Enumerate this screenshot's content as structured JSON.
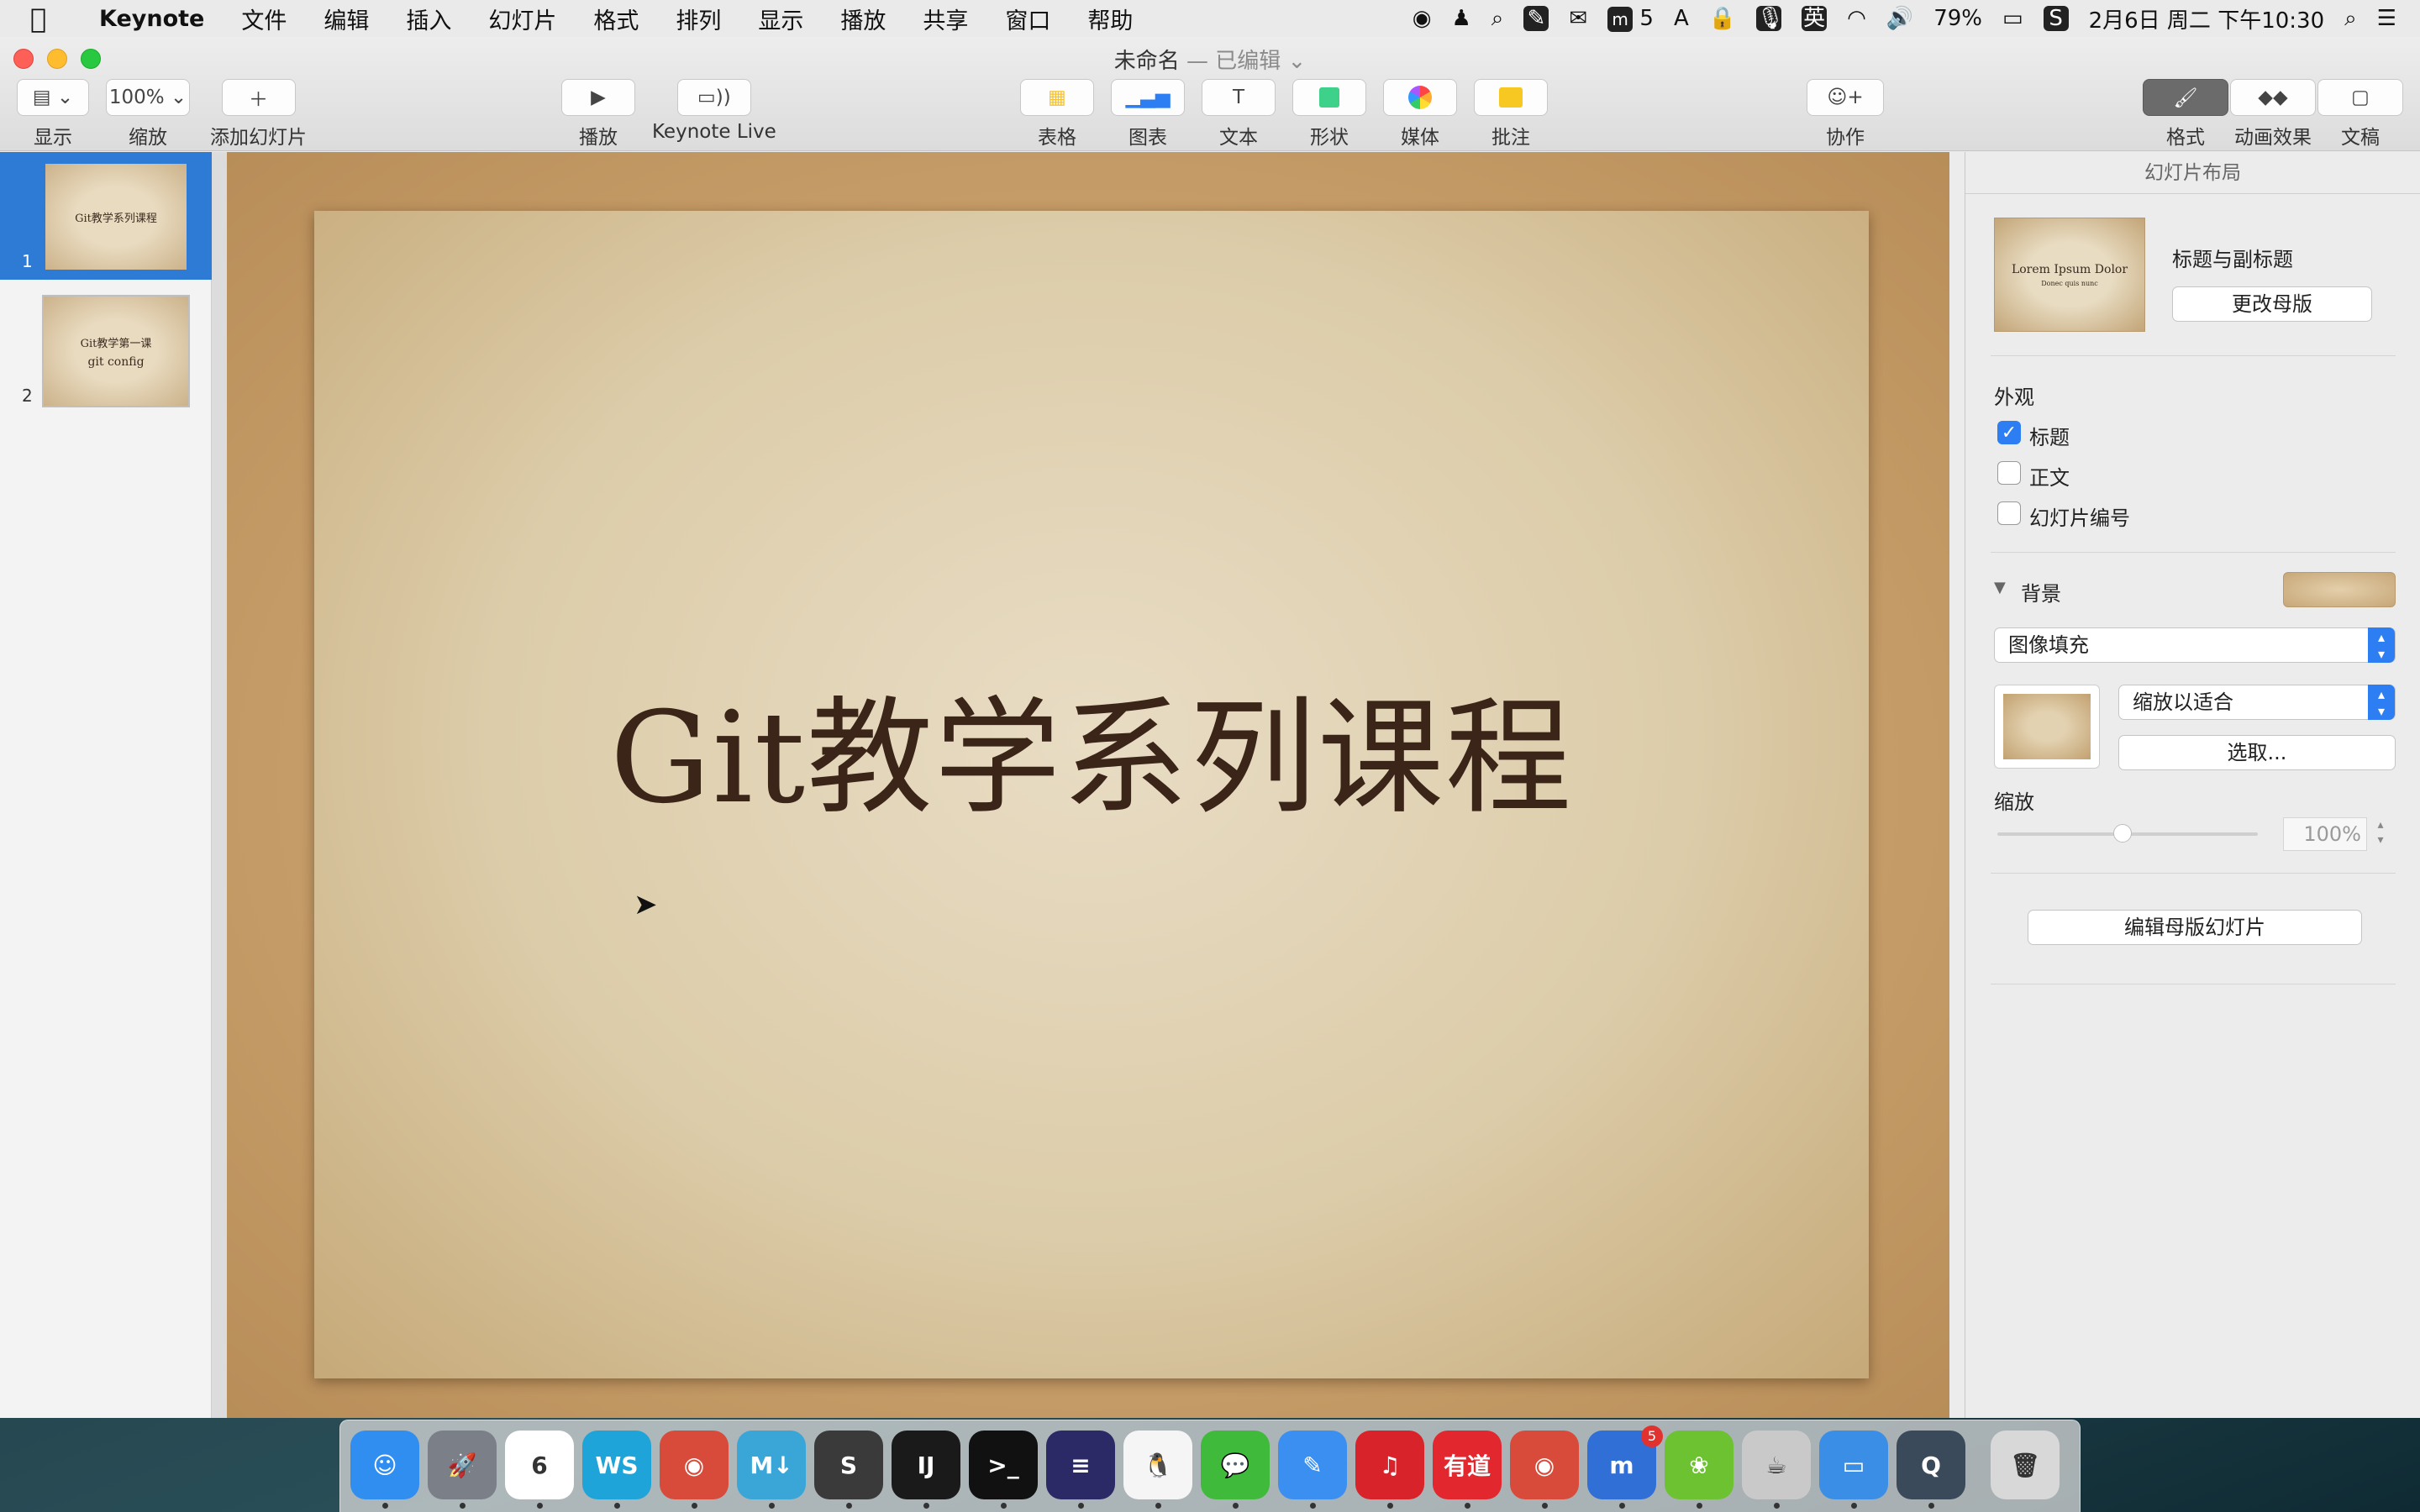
{
  "menubar": {
    "app_name": "Keynote",
    "items": [
      "文件",
      "编辑",
      "插入",
      "幻灯片",
      "格式",
      "排列",
      "显示",
      "播放",
      "共享",
      "窗口",
      "帮助"
    ],
    "status": {
      "m_count": "5",
      "input_method": "英",
      "battery": "79%",
      "datetime": "2月6日 周二 下午10:30"
    }
  },
  "window": {
    "title": "未命名",
    "edited": "— 已编辑"
  },
  "toolbar": {
    "view_label": "显示",
    "zoom_value": "100%",
    "zoom_label": "缩放",
    "add_slide_label": "添加幻灯片",
    "play_label": "播放",
    "keynote_live_label": "Keynote Live",
    "table_label": "表格",
    "chart_label": "图表",
    "text_label": "文本",
    "shape_label": "形状",
    "media_label": "媒体",
    "comment_label": "批注",
    "collaborate_label": "协作",
    "format_label": "格式",
    "animate_label": "动画效果",
    "document_label": "文稿"
  },
  "navigator": {
    "slides": [
      {
        "number": "1",
        "title": "Git教学系列课程",
        "subtitle": ""
      },
      {
        "number": "2",
        "title": "Git教学第一课",
        "subtitle": "git config"
      }
    ]
  },
  "slide": {
    "title": "Git教学系列课程"
  },
  "inspector": {
    "header": "幻灯片布局",
    "layout_name": "标题与副标题",
    "layout_thumb_title": "Lorem Ipsum Dolor",
    "layout_thumb_subtitle": "Donec quis nunc",
    "change_master": "更改母版",
    "appearance_label": "外观",
    "appearance_title": "标题",
    "appearance_title_checked": true,
    "appearance_body": "正文",
    "appearance_body_checked": false,
    "appearance_slide_number": "幻灯片编号",
    "appearance_slide_number_checked": false,
    "background_label": "背景",
    "fill_type": "图像填充",
    "scale_mode": "缩放以适合",
    "choose_button": "选取...",
    "scale_label": "缩放",
    "scale_value": "100%",
    "edit_master": "编辑母版幻灯片"
  },
  "colors": {
    "accent": "#2c7ef2",
    "slide_title": "#3b2418"
  },
  "dock": {
    "apps": [
      {
        "name": "finder-icon",
        "glyph": "☺",
        "color": "#2f8ef0"
      },
      {
        "name": "launchpad-icon",
        "glyph": "🚀",
        "color": "#7a7f88"
      },
      {
        "name": "calendar-icon",
        "glyph": "6",
        "color": "#ffffff"
      },
      {
        "name": "webstorm-icon",
        "glyph": "WS",
        "color": "#1ea4d8"
      },
      {
        "name": "chrome-icon",
        "glyph": "◉",
        "color": "#d84b3b"
      },
      {
        "name": "markdown-icon",
        "glyph": "M↓",
        "color": "#3aa6d8"
      },
      {
        "name": "sublime-icon",
        "glyph": "S",
        "color": "#3a3a3a"
      },
      {
        "name": "intellij-icon",
        "glyph": "IJ",
        "color": "#1a1a1a"
      },
      {
        "name": "terminal-icon",
        "glyph": ">_",
        "color": "#111111"
      },
      {
        "name": "eclipse-icon",
        "glyph": "≡",
        "color": "#2c2a66"
      },
      {
        "name": "qq-icon",
        "glyph": "🐧",
        "color": "#f5f5f5"
      },
      {
        "name": "wechat-icon",
        "glyph": "💬",
        "color": "#3fba3a"
      },
      {
        "name": "pencil-app-icon",
        "glyph": "✎",
        "color": "#3b8ff0"
      },
      {
        "name": "netease-music-icon",
        "glyph": "♫",
        "color": "#d8232a"
      },
      {
        "name": "youdao-icon",
        "glyph": "有道",
        "color": "#e2272f"
      },
      {
        "name": "chrome-2-icon",
        "glyph": "◉",
        "color": "#d84b3b"
      },
      {
        "name": "mweb-icon",
        "glyph": "m",
        "color": "#2f6fd6"
      },
      {
        "name": "leaf-app-icon",
        "glyph": "❀",
        "color": "#6cc230"
      },
      {
        "name": "coffee-app-icon",
        "glyph": "☕",
        "color": "#c9c9c9"
      },
      {
        "name": "keynote-icon",
        "glyph": "▭",
        "color": "#3a8ee6"
      },
      {
        "name": "quicktime-icon",
        "glyph": "Q",
        "color": "#3a4a5a"
      },
      {
        "name": "trash-icon",
        "glyph": "🗑",
        "color": "#d8d8d8"
      }
    ],
    "mweb_badge": "5"
  }
}
